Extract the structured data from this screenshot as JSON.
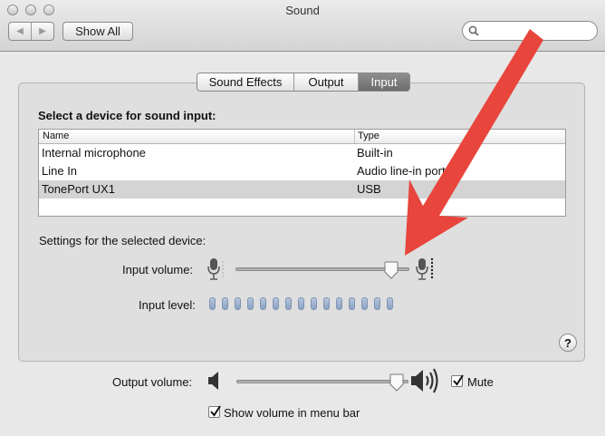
{
  "window": {
    "title": "Sound"
  },
  "toolbar": {
    "back_icon": "◀",
    "forward_icon": "▶",
    "show_all_label": "Show All",
    "search_placeholder": ""
  },
  "tabs": [
    {
      "label": "Sound Effects",
      "active": false
    },
    {
      "label": "Output",
      "active": false
    },
    {
      "label": "Input",
      "active": true
    }
  ],
  "device_section": {
    "heading": "Select a device for sound input:",
    "columns": [
      "Name",
      "Type"
    ],
    "rows": [
      {
        "name": "Internal microphone",
        "type": "Built-in"
      },
      {
        "name": "Line In",
        "type": "Audio line-in port"
      },
      {
        "name": "TonePort UX1",
        "type": "USB",
        "selected": true
      }
    ]
  },
  "settings": {
    "heading": "Settings for the selected device:",
    "input_volume_label": "Input volume:",
    "input_volume": 0.93,
    "input_level_label": "Input level:",
    "input_level_segments": 15,
    "input_level_lit": 0
  },
  "help_icon": "?",
  "output": {
    "volume_label": "Output volume:",
    "volume": 0.97,
    "mute_label": "Mute",
    "mute_checked": true,
    "show_volume_label": "Show volume in menu bar",
    "show_volume_checked": true
  },
  "annotation_arrow_color": "#e8453c"
}
